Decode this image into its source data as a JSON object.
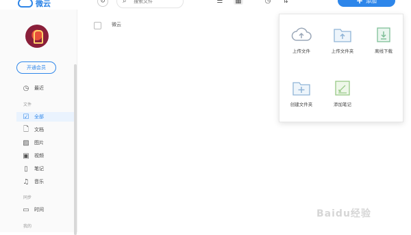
{
  "app": {
    "title": "微云",
    "brand_color": "#2d86ea"
  },
  "toolbar": {
    "refresh_icon": "refresh-icon",
    "search_placeholder": "搜索文件",
    "list_view_icon": "list-icon",
    "grid_view_icon": "grid-icon",
    "history_icon": "clock-icon",
    "sort_icon": "sort-icon",
    "upload_label": "添加"
  },
  "sidebar": {
    "vip_label": "开通会员",
    "recent": {
      "label": "最近",
      "icon": "clock-icon"
    },
    "section_files": "文件",
    "items": [
      {
        "label": "全部",
        "icon": "checkbox-icon",
        "active": true
      },
      {
        "label": "文档",
        "icon": "document-icon"
      },
      {
        "label": "图片",
        "icon": "image-icon"
      },
      {
        "label": "视频",
        "icon": "video-icon"
      },
      {
        "label": "笔记",
        "icon": "note-icon"
      },
      {
        "label": "音乐",
        "icon": "music-icon"
      }
    ],
    "section_tools": "同步",
    "tool_items": [
      {
        "label": "时间",
        "icon": "calendar-icon"
      }
    ],
    "section_mine": "我的"
  },
  "main": {
    "column_name": "微云"
  },
  "add_menu": {
    "items": [
      {
        "label": "上传文件",
        "icon": "cloud-upload-icon"
      },
      {
        "label": "上传文件夹",
        "icon": "folder-upload-icon"
      },
      {
        "label": "离线下载",
        "icon": "offline-download-icon"
      },
      {
        "label": "创建文件夹",
        "icon": "folder-add-icon"
      },
      {
        "label": "添加笔记",
        "icon": "note-add-icon"
      }
    ]
  },
  "watermark": "Baidu经验"
}
